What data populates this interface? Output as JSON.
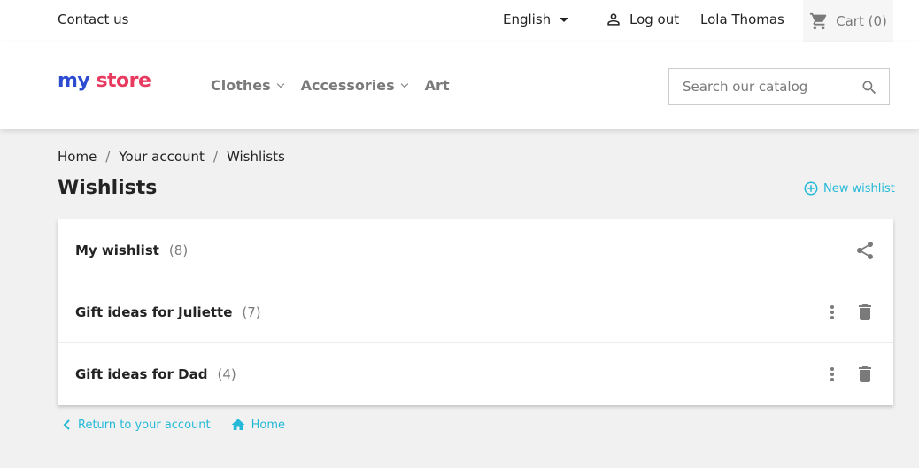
{
  "topbar": {
    "contact": "Contact us",
    "language": "English",
    "logout": "Log out",
    "user": "Lola Thomas",
    "cart": "Cart (0)"
  },
  "header": {
    "logo": {
      "my": "my",
      "store": "store"
    },
    "nav": [
      {
        "label": "Clothes",
        "has_dropdown": true
      },
      {
        "label": "Accessories",
        "has_dropdown": true
      },
      {
        "label": "Art",
        "has_dropdown": false
      }
    ],
    "search_placeholder": "Search our catalog"
  },
  "breadcrumb": [
    "Home",
    "Your account",
    "Wishlists"
  ],
  "page_title": "Wishlists",
  "new_wishlist": "New wishlist",
  "wishlists": [
    {
      "name": "My wishlist",
      "count": "(8)",
      "actions": [
        "share-icon"
      ]
    },
    {
      "name": "Gift ideas for Juliette",
      "count": "(7)",
      "actions": [
        "more-vertical-icon",
        "trash-icon"
      ]
    },
    {
      "name": "Gift ideas for Dad",
      "count": "(4)",
      "actions": [
        "more-vertical-icon",
        "trash-icon"
      ]
    }
  ],
  "footer_links": {
    "return": "Return to your account",
    "home": "Home"
  },
  "colors": {
    "accent": "#24b9d7",
    "text": "#232323",
    "muted": "#7a7a7a",
    "background": "#f1f1f1"
  }
}
